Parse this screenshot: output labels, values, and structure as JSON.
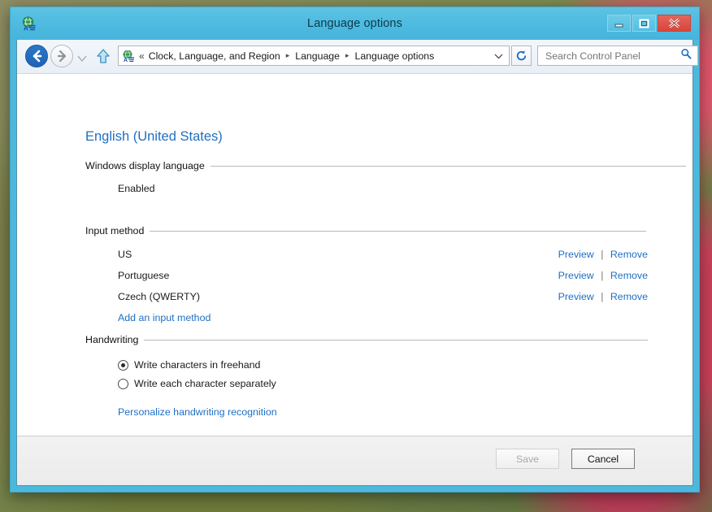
{
  "window": {
    "title": "Language options",
    "icon": "language-globe-icon",
    "controls": {
      "minimize": "Minimize",
      "maximize": "Maximize",
      "close": "Close"
    }
  },
  "toolbar": {
    "back": "Back",
    "forward": "Forward",
    "recent_pages": "Recent pages",
    "up": "Up one level",
    "address_icon": "language-globe-icon",
    "overflow_indicator": "«",
    "breadcrumbs": [
      "Clock, Language, and Region",
      "Language",
      "Language options"
    ],
    "crumb_separator": "▸",
    "dropdown": "Previous locations",
    "refresh": "Refresh",
    "search": {
      "value": "",
      "placeholder": "Search Control Panel",
      "icon": "search-icon"
    }
  },
  "page": {
    "title": "English (United States)",
    "sections": [
      {
        "heading": "Windows display language",
        "rows": [
          {
            "label": "Enabled"
          }
        ]
      },
      {
        "heading": "Input method",
        "rows": [
          {
            "label": "US",
            "preview": "Preview",
            "separator": "|",
            "remove": "Remove"
          },
          {
            "label": "Portuguese",
            "preview": "Preview",
            "separator": "|",
            "remove": "Remove"
          },
          {
            "label": "Czech (QWERTY)",
            "preview": "Preview",
            "separator": "|",
            "remove": "Remove"
          }
        ],
        "add_link": "Add an input method"
      },
      {
        "heading": "Handwriting",
        "radios": [
          {
            "label": "Write characters in freehand",
            "checked": true
          },
          {
            "label": "Write each character separately",
            "checked": false
          }
        ],
        "personalize_link": "Personalize handwriting recognition"
      }
    ]
  },
  "footer": {
    "save": "Save",
    "save_enabled": false,
    "cancel": "Cancel",
    "cancel_enabled": true
  },
  "colors": {
    "frame": "#4db8dd",
    "link": "#1f6fc4",
    "title_text": "#0d3a4a",
    "close_button": "#d8453c",
    "rule": "#b9b9b9"
  }
}
